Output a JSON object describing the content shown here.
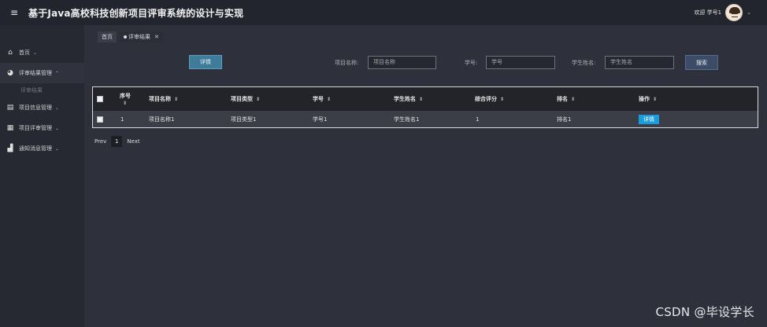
{
  "header": {
    "menu_icon": "menu-icon",
    "title": "基于Java高校科技创新项目评审系统的设计与实现",
    "welcome": "欢迎 学号1",
    "caret": "⌄"
  },
  "sidebar": {
    "items": [
      {
        "label": "首页",
        "icon": "home-icon"
      },
      {
        "label": "评审结果管理",
        "icon": "pie-icon"
      },
      {
        "label": "项目信息管理",
        "icon": "folder-icon"
      },
      {
        "label": "项目评审管理",
        "icon": "grid-icon"
      },
      {
        "label": "通知消息管理",
        "icon": "building-icon"
      }
    ],
    "sub_item": "评审结果"
  },
  "tabs": [
    {
      "label": "首页"
    },
    {
      "label": "评审结果"
    }
  ],
  "toolbar": {
    "detail_label": "详情",
    "search_label": "搜索",
    "fields": [
      {
        "label": "项目名称:",
        "placeholder": "项目名称"
      },
      {
        "label": "学号:",
        "placeholder": "学号"
      },
      {
        "label": "学生姓名:",
        "placeholder": "学生姓名"
      }
    ]
  },
  "table": {
    "columns": [
      "序号",
      "项目名称",
      "项目类型",
      "学号",
      "学生姓名",
      "综合评分",
      "排名",
      "操作"
    ],
    "rows": [
      {
        "seq": "1",
        "name": "项目名称1",
        "type": "项目类型1",
        "student_id": "学号1",
        "student_name": "学生姓名1",
        "score": "1",
        "rank": "排名1",
        "action": "详情"
      }
    ]
  },
  "pager": {
    "prev": "Prev",
    "page": "1",
    "next": "Next"
  },
  "watermark": "CSDN @毕设学长",
  "colors": {
    "header_bg": "#23252e",
    "sidebar_bg": "#272932",
    "content_bg": "#2e303b",
    "detail_button": "#3f7c9a",
    "row_action": "#1a9ddc"
  }
}
